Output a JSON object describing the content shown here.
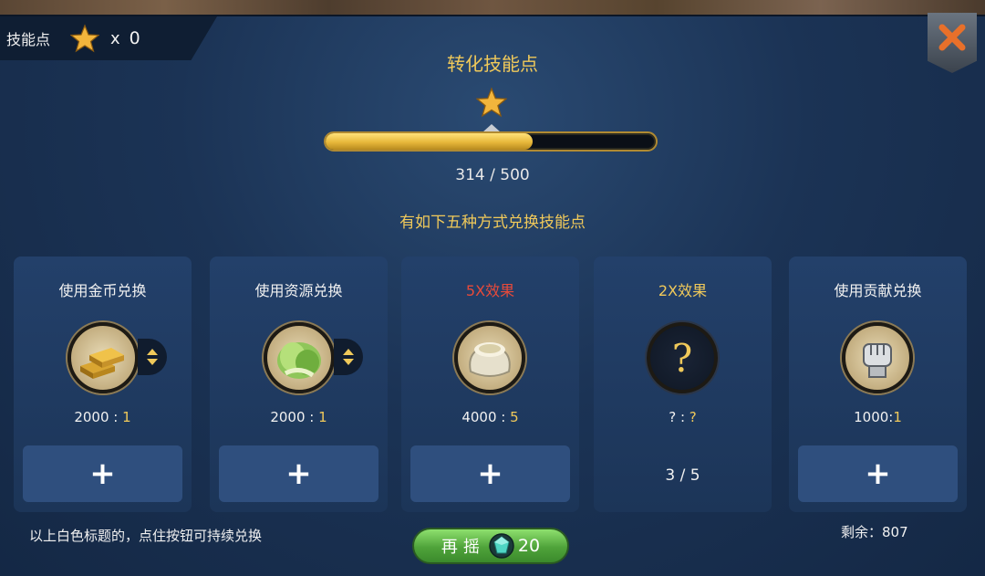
{
  "header": {
    "skill_points_label": "技能点",
    "multiplier": "x",
    "skill_points_value": "0"
  },
  "title": "转化技能点",
  "progress": {
    "text": "314  /  500",
    "fraction": 0.628
  },
  "subtitle": "有如下五种方式兑换技能点",
  "cards": [
    {
      "title": "使用金币兑换",
      "ratio_left": "2000 : ",
      "ratio_right": "1",
      "button": "+",
      "icon": "gold-bars-icon"
    },
    {
      "title": "使用资源兑换",
      "ratio_left": "2000 : ",
      "ratio_right": "1",
      "button": "+",
      "icon": "cabbage-icon"
    },
    {
      "title": "5X效果",
      "ratio_left": "4000 : ",
      "ratio_right": "5",
      "button": "+",
      "icon": "flour-sack-icon"
    },
    {
      "title": "2X效果",
      "ratio_left": "? : ",
      "ratio_right": "?",
      "count": "3  /  5",
      "icon": "question-icon"
    },
    {
      "title": "使用贡献兑换",
      "ratio_left": "1000:",
      "ratio_right": "1",
      "button": "+",
      "icon": "fist-icon"
    }
  ],
  "footer": {
    "note": "以上白色标题的，点住按钮可持续兑换",
    "remaining": "剩余：807",
    "reroll_label": "再摇",
    "reroll_cost": "20"
  },
  "colors": {
    "gold": "#f0c95a",
    "red": "#e84a3a",
    "panel": "#23406a",
    "button": "#2f4f7e",
    "green": "#4fa33a"
  }
}
